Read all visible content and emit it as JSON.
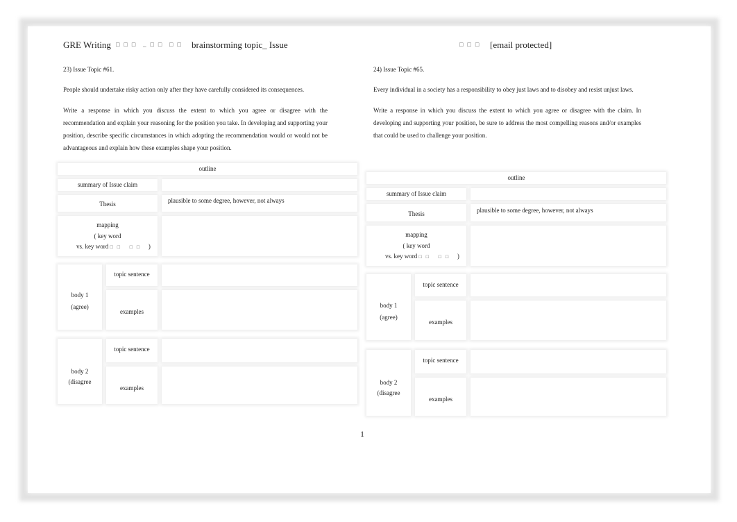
{
  "header": {
    "title": "GRE Writing",
    "tofu1": "□□□",
    "tofu2": "_□□",
    "tofu3": "□□",
    "subtitle": "brainstorming topic_ Issue",
    "tofu4": "□□□",
    "email": "[email protected]"
  },
  "topics": [
    {
      "number": "23) Issue Topic #61.",
      "claim": "People should undertake risky action only after they have carefully considered its consequences.",
      "instructions": "Write a response in which you discuss the extent to which you agree or disagree with the recommendation and explain your reasoning for the position you take. In developing and supporting your position, describe specific circumstances in which adopting the recommendation would or would not be advantageous and explain how these examples shape your position."
    },
    {
      "number": "24) Issue Topic #65.",
      "claim": "Every individual in a society has a responsibility to obey just laws and to disobey and resist unjust laws.",
      "instructions": "Write a response in which you discuss the extent to which you agree or disagree with the claim. In developing and supporting your position, be sure to address the most compelling reasons and/or examples that could be used to challenge your position."
    }
  ],
  "outline": {
    "title": "outline",
    "summary": "summary of Issue claim",
    "thesis": "Thesis",
    "thesis_value": "plausible to some degree, however, not always",
    "mapping1": "mapping",
    "mapping2": "( key word",
    "mapping3": "vs. key word",
    "mapping_tofu": "□□ □□",
    "mapping_close": ")",
    "body1": "body 1",
    "body1_sub": "(agree)",
    "body2": "body 2",
    "body2_sub": "(disagree",
    "topic_sentence": "topic sentence",
    "examples": "examples"
  },
  "page_number": "1"
}
